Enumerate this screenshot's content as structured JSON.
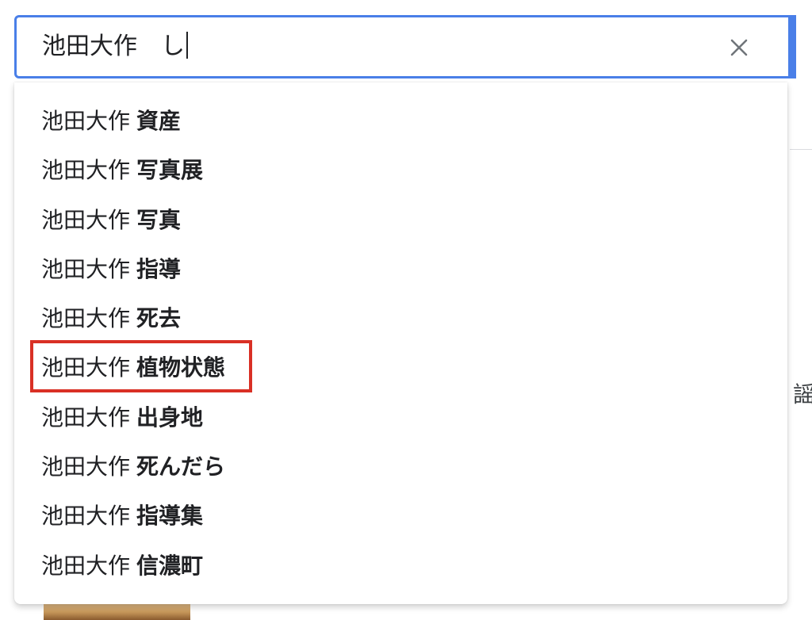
{
  "search": {
    "value": "池田大作　し",
    "clear_icon": "close-icon"
  },
  "background": {
    "partial_char": "謡"
  },
  "suggestions": [
    {
      "prefix": "池田大作",
      "suffix": "資産"
    },
    {
      "prefix": "池田大作",
      "suffix": "写真展"
    },
    {
      "prefix": "池田大作",
      "suffix": "写真"
    },
    {
      "prefix": "池田大作",
      "suffix": "指導"
    },
    {
      "prefix": "池田大作",
      "suffix": "死去"
    },
    {
      "prefix": "池田大作",
      "suffix": "植物状態"
    },
    {
      "prefix": "池田大作",
      "suffix": "出身地"
    },
    {
      "prefix": "池田大作",
      "suffix": "死んだら"
    },
    {
      "prefix": "池田大作",
      "suffix": "指導集"
    },
    {
      "prefix": "池田大作",
      "suffix": "信濃町"
    }
  ],
  "highlighted_index": 5,
  "colors": {
    "focus_border": "#4a7fe8",
    "highlight_box": "#d93025",
    "text": "#202124"
  }
}
